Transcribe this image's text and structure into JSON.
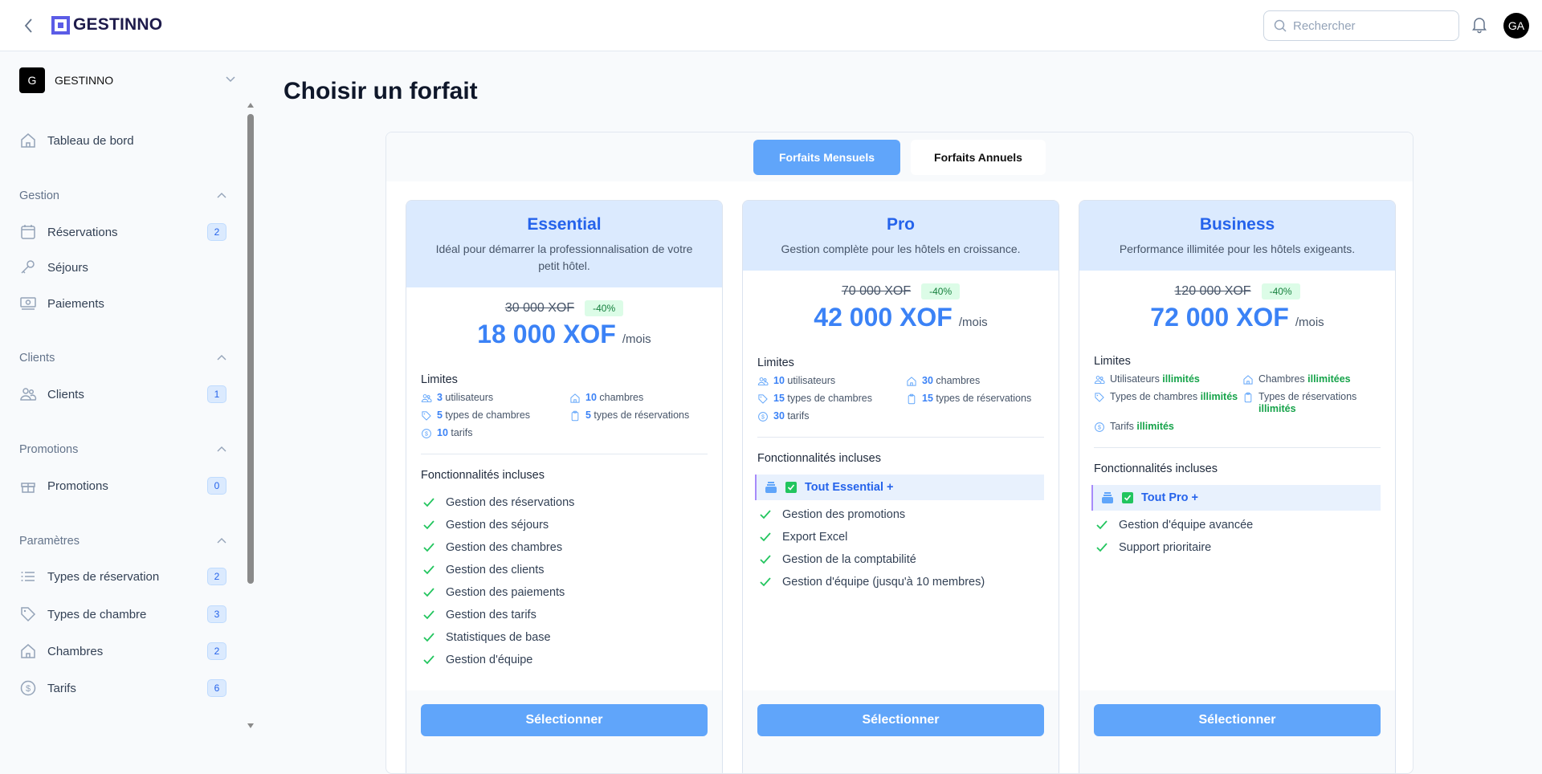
{
  "header": {
    "brand": "GESTINNO",
    "search_placeholder": "Rechercher",
    "avatar": "GA"
  },
  "sidebar": {
    "workspace": {
      "initial": "G",
      "name": "GESTINNO"
    },
    "dashboard": {
      "label": "Tableau de bord",
      "icon": "home-icon"
    },
    "sections": [
      {
        "title": "Gestion",
        "items": [
          {
            "label": "Réservations",
            "icon": "calendar-icon",
            "badge": "2"
          },
          {
            "label": "Séjours",
            "icon": "key-icon"
          },
          {
            "label": "Paiements",
            "icon": "banknote-icon"
          }
        ]
      },
      {
        "title": "Clients",
        "items": [
          {
            "label": "Clients",
            "icon": "users-icon",
            "badge": "1"
          }
        ]
      },
      {
        "title": "Promotions",
        "items": [
          {
            "label": "Promotions",
            "icon": "gift-icon",
            "badge": "0"
          }
        ]
      },
      {
        "title": "Paramètres",
        "items": [
          {
            "label": "Types de réservation",
            "icon": "list-icon",
            "badge": "2"
          },
          {
            "label": "Types de chambre",
            "icon": "tag-icon",
            "badge": "3"
          },
          {
            "label": "Chambres",
            "icon": "home-icon",
            "badge": "2"
          },
          {
            "label": "Tarifs",
            "icon": "dollar-icon",
            "badge": "6"
          }
        ]
      }
    ]
  },
  "main": {
    "title": "Choisir un forfait",
    "tabs": [
      {
        "label": "Forfaits Mensuels",
        "active": true
      },
      {
        "label": "Forfaits Annuels",
        "active": false
      }
    ],
    "limits_title": "Limites",
    "features_title": "Fonctionnalités incluses",
    "select_label": "Sélectionner",
    "plans": [
      {
        "name": "Essential",
        "description": "Idéal pour démarrer la professionnalisation de votre petit hôtel.",
        "old_price": "30 000 XOF",
        "discount": "-40%",
        "price": "18 000 XOF",
        "period": "/mois",
        "limits": [
          {
            "icon": "users-icon",
            "pre": "",
            "strong": "3",
            "post": " utilisateurs",
            "kind": "n"
          },
          {
            "icon": "home-icon",
            "pre": "",
            "strong": "10",
            "post": " chambres",
            "kind": "n"
          },
          {
            "icon": "tag-icon",
            "pre": "",
            "strong": "5",
            "post": " types de chambres",
            "kind": "n"
          },
          {
            "icon": "clipboard-icon",
            "pre": "",
            "strong": "5",
            "post": " types de réservations",
            "kind": "n"
          },
          {
            "icon": "dollar-icon",
            "pre": "",
            "strong": "10",
            "post": " tarifs",
            "kind": "n"
          }
        ],
        "highlight": null,
        "features": [
          "Gestion des réservations",
          "Gestion des séjours",
          "Gestion des chambres",
          "Gestion des clients",
          "Gestion des paiements",
          "Gestion des tarifs",
          "Statistiques de base",
          "Gestion d'équipe"
        ]
      },
      {
        "name": "Pro",
        "description": "Gestion complète pour les hôtels en croissance.",
        "old_price": "70 000 XOF",
        "discount": "-40%",
        "price": "42 000 XOF",
        "period": "/mois",
        "limits": [
          {
            "icon": "users-icon",
            "pre": "",
            "strong": "10",
            "post": " utilisateurs",
            "kind": "n"
          },
          {
            "icon": "home-icon",
            "pre": "",
            "strong": "30",
            "post": " chambres",
            "kind": "n"
          },
          {
            "icon": "tag-icon",
            "pre": "",
            "strong": "15",
            "post": " types de chambres",
            "kind": "n"
          },
          {
            "icon": "clipboard-icon",
            "pre": "",
            "strong": "15",
            "post": " types de réservations",
            "kind": "n"
          },
          {
            "icon": "dollar-icon",
            "pre": "",
            "strong": "30",
            "post": " tarifs",
            "kind": "n"
          }
        ],
        "highlight": "Tout Essential +",
        "features": [
          "Gestion des promotions",
          "Export Excel",
          "Gestion de la comptabilité",
          "Gestion d'équipe (jusqu'à 10 membres)"
        ]
      },
      {
        "name": "Business",
        "description": "Performance illimitée pour les hôtels exigeants.",
        "old_price": "120 000 XOF",
        "discount": "-40%",
        "price": "72 000 XOF",
        "period": "/mois",
        "limits": [
          {
            "icon": "users-icon",
            "pre": "Utilisateurs ",
            "strong": "illimités",
            "post": "",
            "kind": "u"
          },
          {
            "icon": "home-icon",
            "pre": "Chambres ",
            "strong": "illimitées",
            "post": "",
            "kind": "u"
          },
          {
            "icon": "tag-icon",
            "pre": "Types de chambres ",
            "strong": "illimités",
            "post": "",
            "kind": "u"
          },
          {
            "icon": "clipboard-icon",
            "pre": "Types de réservations ",
            "strong": "illimités",
            "post": "",
            "kind": "u"
          },
          {
            "icon": "dollar-icon",
            "pre": "Tarifs ",
            "strong": "illimités",
            "post": "",
            "kind": "u"
          }
        ],
        "highlight": "Tout Pro +",
        "features": [
          "Gestion d'équipe avancée",
          "Support prioritaire"
        ]
      }
    ]
  },
  "colors": {
    "accent": "#60a5fa",
    "brand": "#5b5ce6",
    "success": "#22c55e",
    "plan_header": "#dbeafe"
  }
}
